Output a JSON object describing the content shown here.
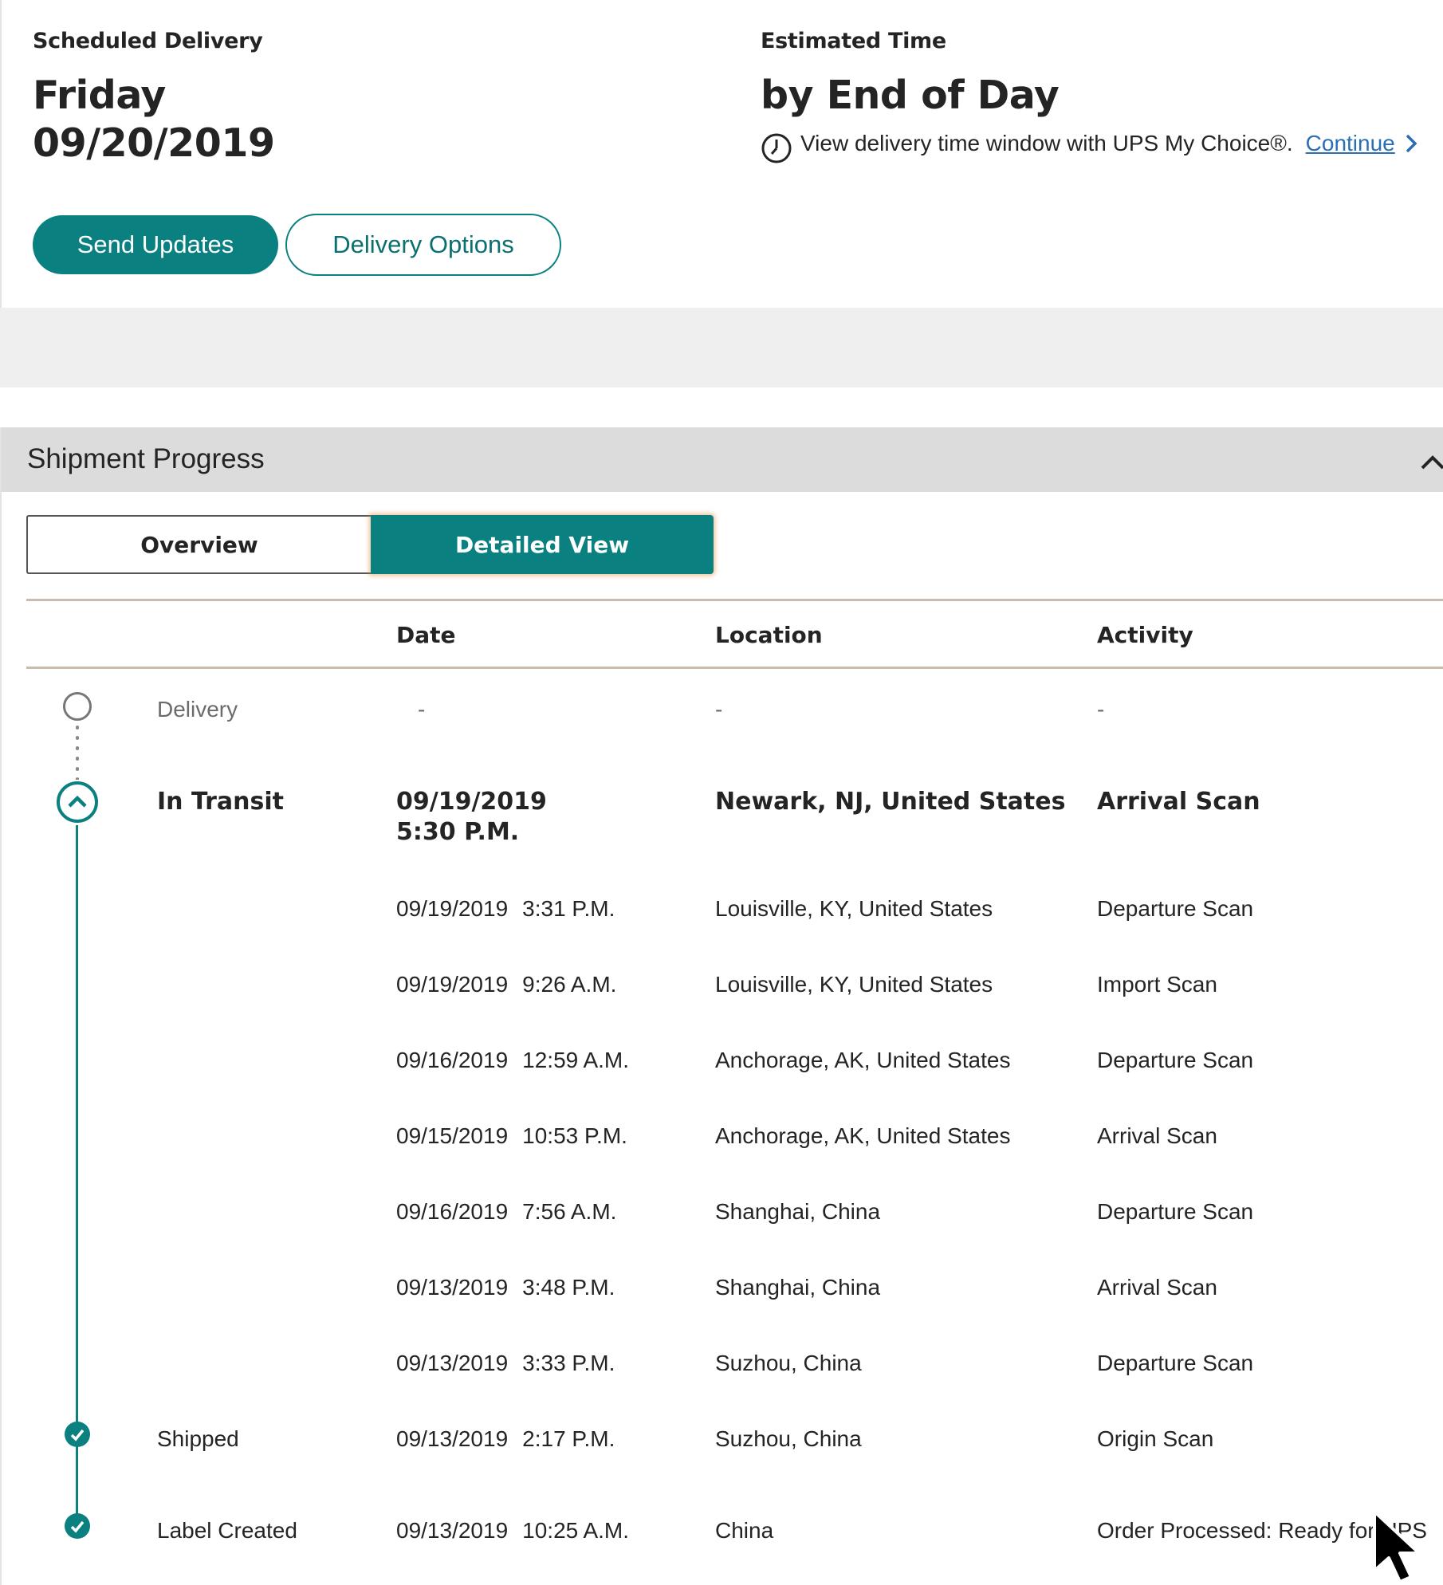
{
  "delivery": {
    "scheduled_label": "Scheduled Delivery",
    "day": "Friday",
    "date": "09/20/2019",
    "estimated_label": "Estimated Time",
    "estimated_value": "by End of Day",
    "time_window_text": "View delivery time window with UPS My Choice®.",
    "continue_link": "Continue",
    "send_updates_label": "Send Updates",
    "delivery_options_label": "Delivery Options"
  },
  "progress": {
    "title": "Shipment Progress",
    "tabs": {
      "overview": "Overview",
      "detailed": "Detailed View",
      "selected": "Detailed View"
    },
    "columns": {
      "date": "Date",
      "location": "Location",
      "activity": "Activity"
    },
    "rows": [
      {
        "status": "Delivery",
        "date": "-",
        "time": "",
        "location": "-",
        "activity": "-"
      },
      {
        "status": "In Transit",
        "date": "09/19/2019",
        "time": "5:30 P.M.",
        "location": "Newark, NJ, United States",
        "activity": "Arrival Scan"
      },
      {
        "status": "",
        "date": "09/19/2019",
        "time": "3:31 P.M.",
        "location": "Louisville, KY, United States",
        "activity": "Departure Scan"
      },
      {
        "status": "",
        "date": "09/19/2019",
        "time": "9:26 A.M.",
        "location": "Louisville, KY, United States",
        "activity": "Import Scan"
      },
      {
        "status": "",
        "date": "09/16/2019",
        "time": "12:59 A.M.",
        "location": "Anchorage, AK, United States",
        "activity": "Departure Scan"
      },
      {
        "status": "",
        "date": "09/15/2019",
        "time": "10:53 P.M.",
        "location": "Anchorage, AK, United States",
        "activity": "Arrival Scan"
      },
      {
        "status": "",
        "date": "09/16/2019",
        "time": "7:56 A.M.",
        "location": "Shanghai, China",
        "activity": "Departure Scan"
      },
      {
        "status": "",
        "date": "09/13/2019",
        "time": "3:48 P.M.",
        "location": "Shanghai, China",
        "activity": "Arrival Scan"
      },
      {
        "status": "",
        "date": "09/13/2019",
        "time": "3:33 P.M.",
        "location": "Suzhou, China",
        "activity": "Departure Scan"
      },
      {
        "status": "Shipped",
        "date": "09/13/2019",
        "time": "2:17 P.M.",
        "location": "Suzhou, China",
        "activity": "Origin Scan"
      },
      {
        "status": "Label Created",
        "date": "09/13/2019",
        "time": "10:25 A.M.",
        "location": "China",
        "activity": "Order Processed: Ready for UPS"
      }
    ]
  },
  "colors": {
    "brand_teal": "#0a8080",
    "link_blue": "#2a6eb4",
    "rule_tan": "#c8bcae"
  }
}
